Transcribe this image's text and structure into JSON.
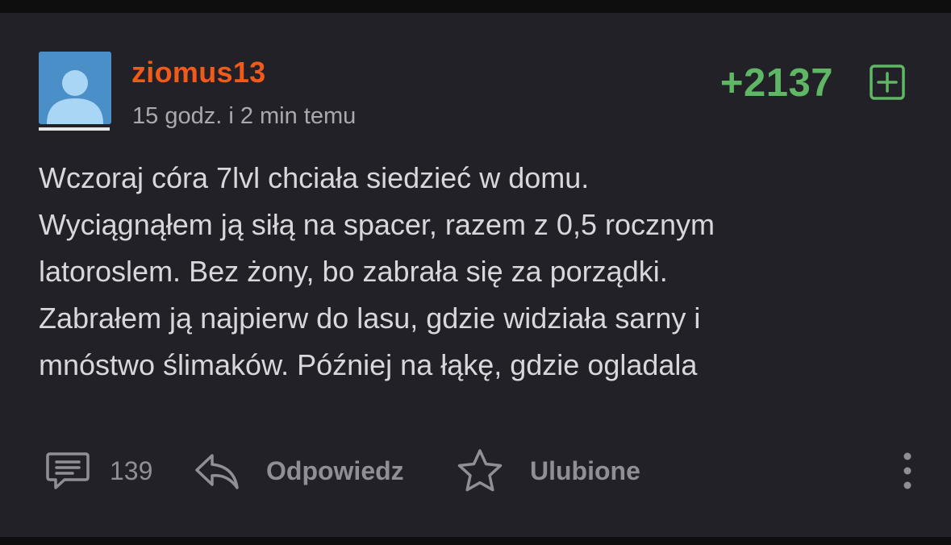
{
  "post": {
    "author": "ziomus13",
    "timestamp": "15 godz. i 2 min temu",
    "score": "+2137",
    "body_lines": [
      "Wczoraj córa 7lvl chciała siedzieć w domu.",
      "Wyciągnąłem ją siłą na spacer, razem z 0,5 rocznym",
      "latoroslem. Bez żony, bo zabrała się za porządki.",
      "Zabrałem ją najpierw do lasu, gdzie widziała sarny i",
      "mnóstwo ślimaków. Później na łąkę, gdzie ogladala"
    ]
  },
  "footer": {
    "comment_count": "139",
    "reply_label": "Odpowiedz",
    "favorite_label": "Ulubione"
  },
  "icons": {
    "avatar": "user-avatar-icon",
    "vote": "plus-square-icon",
    "comments": "comment-icon",
    "reply": "reply-arrow-icon",
    "favorite": "star-icon",
    "more": "more-vertical-icon"
  },
  "colors": {
    "author": "#f05a1a",
    "score": "#5fb765",
    "background": "#222127"
  }
}
